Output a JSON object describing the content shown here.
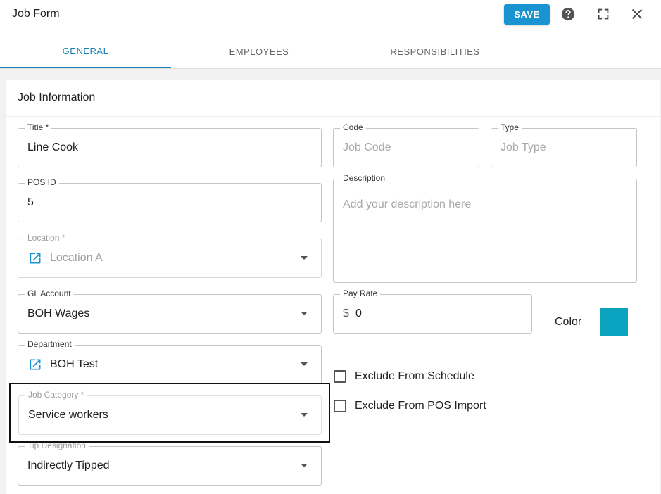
{
  "header": {
    "title": "Job Form",
    "save_label": "SAVE",
    "icons": [
      "help-icon",
      "fullscreen-icon",
      "close-icon"
    ]
  },
  "tabs": [
    {
      "label": "GENERAL",
      "active": true
    },
    {
      "label": "EMPLOYEES",
      "active": false
    },
    {
      "label": "RESPONSIBILITIES",
      "active": false
    }
  ],
  "section": {
    "title": "Job Information"
  },
  "fields": {
    "title": {
      "label": "Title *",
      "value": "Line Cook"
    },
    "code": {
      "label": "Code",
      "placeholder": "Job Code"
    },
    "type": {
      "label": "Type",
      "placeholder": "Job Type"
    },
    "pos_id": {
      "label": "POS ID",
      "value": "5"
    },
    "description": {
      "label": "Description",
      "placeholder": "Add your description here"
    },
    "location": {
      "label": "Location *",
      "value": "Location A",
      "disabled": true
    },
    "gl_account": {
      "label": "GL Account",
      "value": "BOH Wages"
    },
    "pay_rate": {
      "label": "Pay Rate",
      "prefix": "$",
      "value": "0"
    },
    "department": {
      "label": "Department",
      "value": "BOH Test"
    },
    "job_category": {
      "label": "Job Category *",
      "value": "Service workers"
    },
    "tip_designation": {
      "label": "Tip Designation",
      "value": "Indirectly Tipped"
    }
  },
  "color": {
    "label": "Color",
    "value": "#0aa3bf"
  },
  "checkboxes": [
    {
      "label": "Exclude From Schedule",
      "checked": false
    },
    {
      "label": "Exclude From POS Import",
      "checked": false
    }
  ],
  "theme": {
    "accent": "#1a93d1",
    "tab_active": "#1a7fb5",
    "link_icon": "#1a93d1"
  }
}
